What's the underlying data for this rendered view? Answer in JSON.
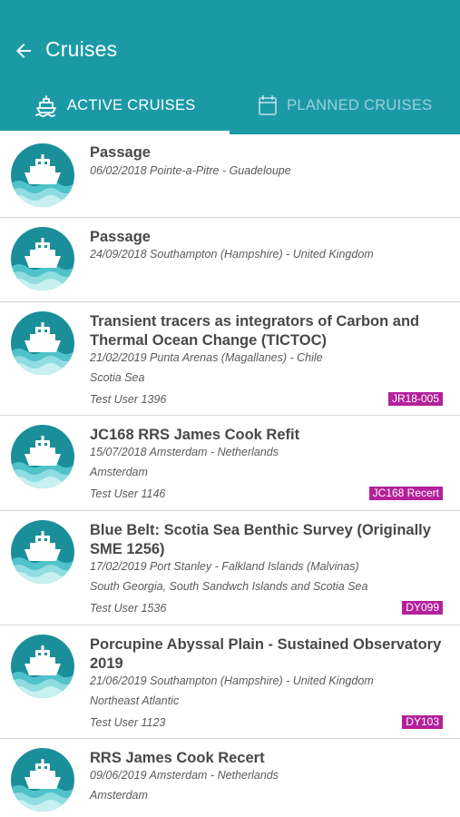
{
  "header": {
    "title": "Cruises"
  },
  "tabs": [
    {
      "label": "ACTIVE CRUISES",
      "icon": "ship-icon",
      "active": true
    },
    {
      "label": "PLANNED CRUISES",
      "icon": "calendar-icon",
      "active": false
    }
  ],
  "colors": {
    "primary": "#1b9aa6",
    "badge": "#b3219b",
    "divider": "#d6d6d6"
  },
  "cruises": [
    {
      "title": "Passage",
      "subtitle": "06/02/2018 Pointe-a-Pitre - Guadeloupe"
    },
    {
      "title": "Passage",
      "subtitle": "24/09/2018 Southampton (Hampshire) - United Kingdom"
    },
    {
      "title": "Transient tracers as integrators of Carbon and Thermal Ocean Change (TICTOC)",
      "subtitle": "21/02/2019 Punta Arenas (Magallanes) - Chile",
      "region": "Scotia Sea",
      "user": "Test User 1396",
      "badge": "JR18-005"
    },
    {
      "title": "JC168 RRS James Cook Refit",
      "subtitle": "15/07/2018 Amsterdam - Netherlands",
      "region": "Amsterdam",
      "user": "Test User 1146",
      "badge": "JC168 Recert"
    },
    {
      "title": "Blue Belt: Scotia Sea Benthic Survey (Originally SME 1256)",
      "subtitle": "17/02/2019 Port Stanley - Falkland Islands (Malvinas)",
      "region": "South Georgia, South Sandwch Islands and Scotia Sea",
      "user": "Test User 1536",
      "badge": "DY099"
    },
    {
      "title": "Porcupine Abyssal Plain - Sustained Observatory 2019",
      "subtitle": "21/06/2019 Southampton (Hampshire) - United Kingdom",
      "region": "Northeast Atlantic",
      "user": "Test User 1123",
      "badge": "DY103"
    },
    {
      "title": "RRS James Cook Recert",
      "subtitle": "09/06/2019 Amsterdam - Netherlands",
      "region": "Amsterdam",
      "user": "",
      "badge": ""
    }
  ]
}
